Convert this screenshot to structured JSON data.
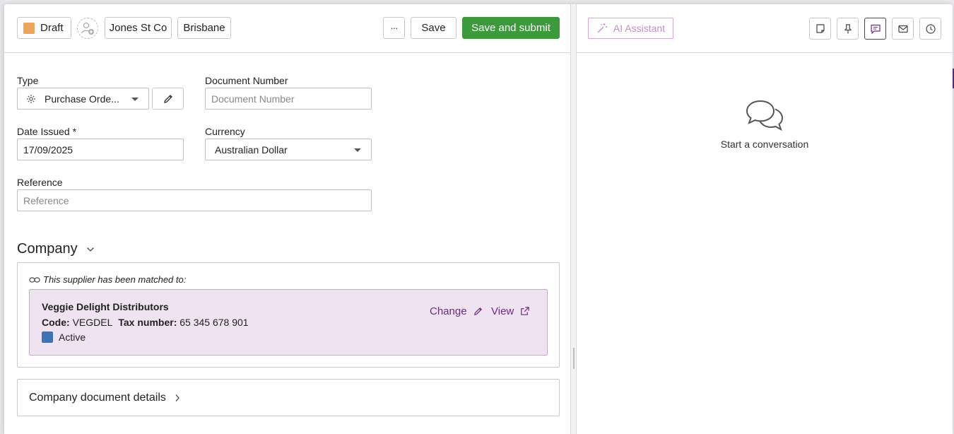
{
  "header": {
    "status_label": "Draft",
    "status_color": "#e9a55b",
    "tag1": "Jones St Co",
    "tag2": "Brisbane",
    "more_label": "···",
    "save_label": "Save",
    "submit_label": "Save and submit"
  },
  "form": {
    "type_label": "Type",
    "type_value": "Purchase Orde...",
    "docnum_label": "Document Number",
    "docnum_placeholder": "Document Number",
    "date_label": "Date Issued *",
    "date_value": "17/09/2025",
    "currency_label": "Currency",
    "currency_value": "Australian Dollar",
    "reference_label": "Reference",
    "reference_placeholder": "Reference"
  },
  "company": {
    "section_title": "Company",
    "matched_text": "This supplier has been matched to:",
    "supplier_name": "Veggie Delight Distributors",
    "code_label": "Code:",
    "code_value": "VEGDEL",
    "tax_label": "Tax number:",
    "tax_value": "65 345 678 901",
    "status_text": "Active",
    "status_color": "#3e74b5",
    "change_label": "Change",
    "view_label": "View",
    "details_label": "Company document details"
  },
  "right": {
    "ai_label": "AI Assistant",
    "empty_text": "Start a conversation",
    "icons": [
      "note-icon",
      "pin-icon",
      "chat-icon",
      "mail-icon",
      "history-icon"
    ],
    "active_icon": "chat-icon"
  },
  "colors": {
    "accent": "#6a2e7e",
    "submit": "#3c9a3c",
    "match_bg": "#efe3f1"
  }
}
